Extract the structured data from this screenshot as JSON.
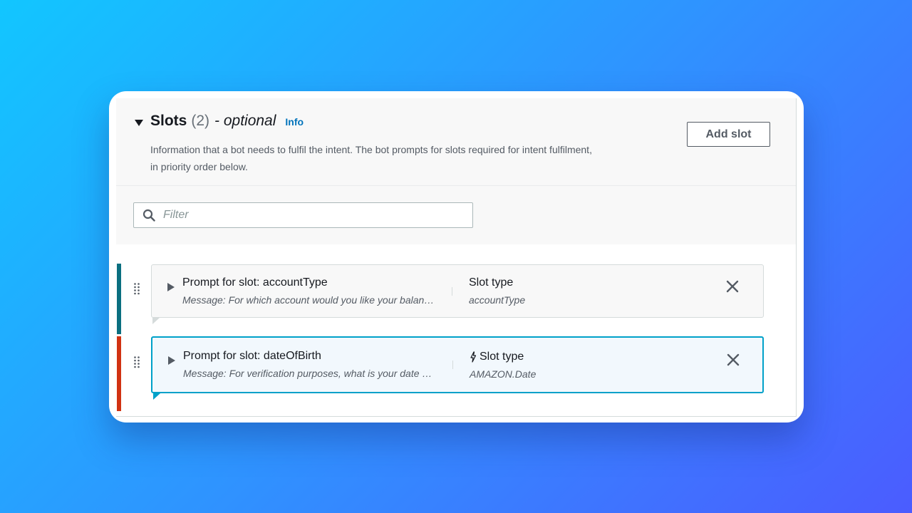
{
  "slots_panel": {
    "title": "Slots",
    "count": "(2)",
    "optional": "- optional",
    "info_link": "Info",
    "description": "Information that a bot needs to fulfil the intent. The bot prompts for slots required for intent fulfilment, in priority order below.",
    "add_button": "Add slot",
    "filter": {
      "placeholder": "Filter"
    },
    "slots": [
      {
        "prompt": "Prompt for slot: accountType",
        "message": "Message: For which account would you like your balan…",
        "slot_type_label": "Slot type",
        "slot_type_value": "accountType",
        "accent_color": "#0a6f80"
      },
      {
        "prompt": "Prompt for slot: dateOfBirth",
        "message": "Message: For verification purposes, what is your date …",
        "slot_type_label": "Slot type",
        "slot_type_value": "AMAZON.Date",
        "accent_color": "#d13212"
      }
    ]
  },
  "colors": {
    "background_start": "#12c6ff",
    "background_end": "#4b5cff",
    "link": "#0073bb",
    "focus_border": "#00a1c9"
  }
}
